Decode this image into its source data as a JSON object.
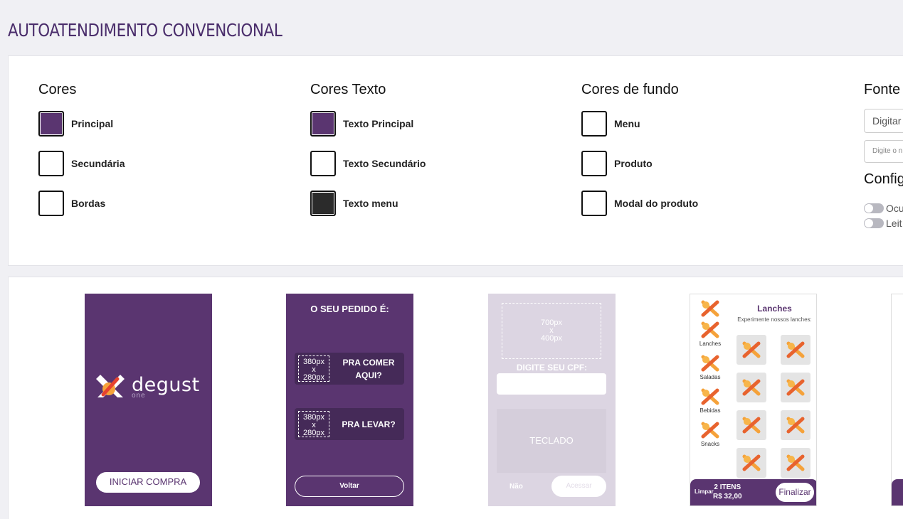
{
  "page": {
    "title": "AUTOATENDIMENTO CONVENCIONAL"
  },
  "colors": {
    "title": "Cores",
    "items": [
      {
        "label": "Principal",
        "color": "#5a3570"
      },
      {
        "label": "Secundária",
        "color": "#ffffff"
      },
      {
        "label": "Bordas",
        "color": "#ffffff"
      }
    ]
  },
  "text_colors": {
    "title": "Cores Texto",
    "items": [
      {
        "label": "Texto Principal",
        "color": "#5a3570"
      },
      {
        "label": "Texto Secundário",
        "color": "#ffffff"
      },
      {
        "label": "Texto menu",
        "color": "#2b2b2b"
      }
    ]
  },
  "bg_colors": {
    "title": "Cores de fundo",
    "items": [
      {
        "label": "Menu",
        "color": "#ffffff"
      },
      {
        "label": "Produto",
        "color": "#ffffff"
      },
      {
        "label": "Modal do produto",
        "color": "#ffffff"
      }
    ]
  },
  "font": {
    "title": "Fonte",
    "input_placeholder": "Digitar",
    "input2_placeholder": "Digite o n",
    "config_title": "Config",
    "toggles": [
      {
        "label": "Ocu"
      },
      {
        "label": "Leit"
      }
    ]
  },
  "previews": {
    "start": {
      "logo_text": "degust",
      "logo_sub": "one",
      "button": "INICIAR COMPRA"
    },
    "order_type": {
      "title": "O SEU PEDIDO É:",
      "placeholder_size": "380px\nx\n280px",
      "option1": "PRA COMER AQUI?",
      "option2": "PRA LEVAR?",
      "back": "Voltar"
    },
    "cpf": {
      "placeholder_size": "700px\nx\n400px",
      "label": "DIGITE SEU CPF:",
      "keyboard": "TECLADO",
      "no": "Não",
      "access": "Acessar"
    },
    "menu": {
      "title": "Lanches",
      "subtitle": "Experimente nossos lanches:",
      "categories": [
        "Lanches",
        "Saladas",
        "Bebidas",
        "Snacks"
      ],
      "clear": "Limpar",
      "items_count": "2 ITENS",
      "total": "R$ 32,00",
      "finish": "Finalizar"
    }
  }
}
